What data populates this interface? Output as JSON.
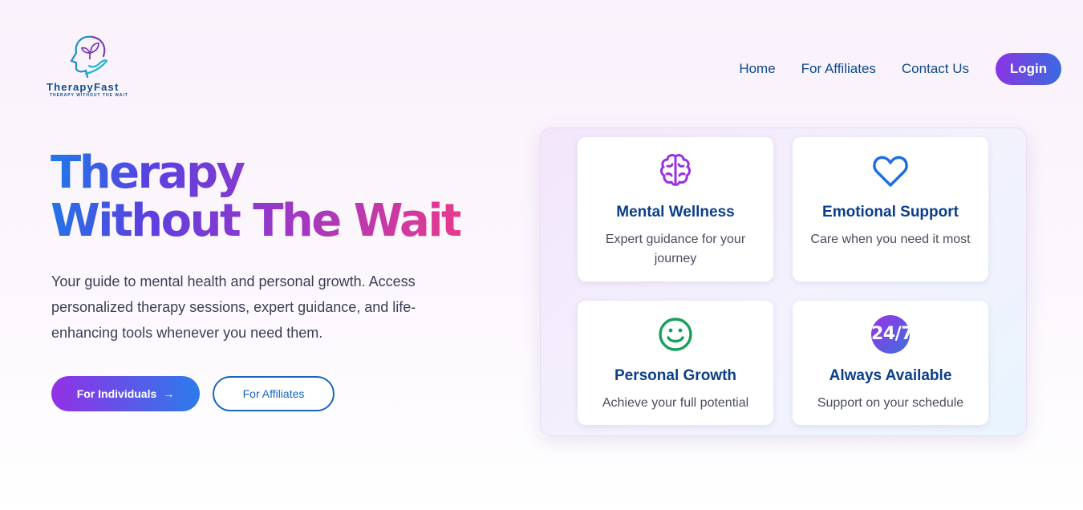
{
  "brand": {
    "name": "TherapyFast",
    "tagline": "THERAPY WITHOUT THE WAIT",
    "logo_icon": "head-with-leaf-and-hand-icon"
  },
  "nav": {
    "items": [
      "Home",
      "For Affiliates",
      "Contact Us"
    ],
    "login_label": "Login"
  },
  "hero": {
    "title_line1": "Therapy",
    "title_line2": "Without The Wait",
    "subtitle": "Your guide to mental health and personal growth. Access personalized therapy sessions, expert guidance, and life-enhancing tools whenever you need them.",
    "primary_button": "For Individuals",
    "primary_button_icon": "arrow-right-icon",
    "secondary_button": "For Affiliates"
  },
  "features": [
    {
      "icon": "brain-icon",
      "title": "Mental Wellness",
      "desc": "Expert guidance for your journey",
      "color": "#9b30e0"
    },
    {
      "icon": "heart-icon",
      "title": "Emotional Support",
      "desc": "Care when you need it most",
      "color": "#1a6fe0"
    },
    {
      "icon": "smiley-icon",
      "title": "Personal Growth",
      "desc": "Achieve your full potential",
      "color": "#16a05a"
    },
    {
      "icon": "24-7-badge-icon",
      "badge_text": "24/7",
      "title": "Always Available",
      "desc": "Support on your schedule"
    }
  ],
  "colors": {
    "nav_text": "#0d4a8c",
    "card_title": "#0b3f8a",
    "gradient_start": "#9330e6",
    "gradient_end": "#2b7bea"
  }
}
